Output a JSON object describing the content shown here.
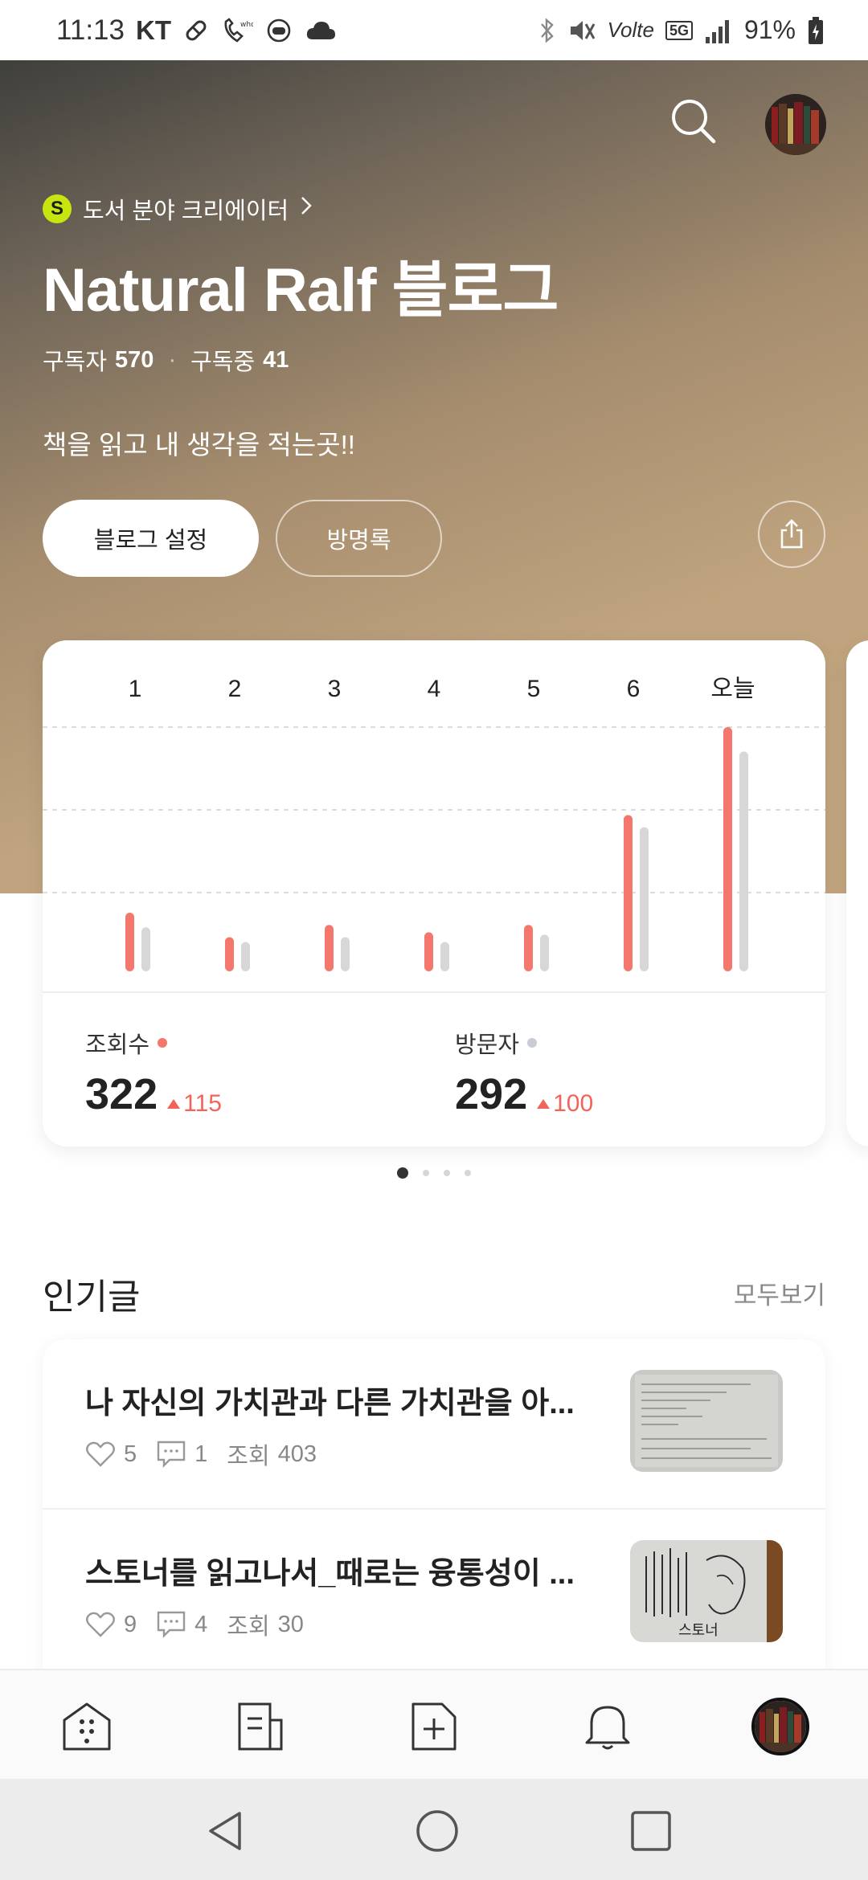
{
  "status_bar": {
    "time": "11:13",
    "carrier": "KT",
    "volte": "Volte",
    "network": "5G",
    "battery": "91%"
  },
  "hero": {
    "category_badge": "S",
    "category": "도서 분야 크리에이터",
    "title": "Natural Ralf 블로그",
    "subscribers_label": "구독자",
    "subscribers": "570",
    "subscribing_label": "구독중",
    "subscribing": "41",
    "description": "책을 읽고 내 생각을 적는곳!!",
    "settings_button": "블로그 설정",
    "guestbook_button": "방명록"
  },
  "stats": {
    "views_label": "조회수",
    "views": "322",
    "views_delta": "115",
    "visitors_label": "방문자",
    "visitors": "292",
    "visitors_delta": "100"
  },
  "chart_data": {
    "type": "bar",
    "categories": [
      "1",
      "2",
      "3",
      "4",
      "5",
      "6",
      "오늘"
    ],
    "series": [
      {
        "name": "조회수",
        "values": [
          48,
          28,
          38,
          32,
          38,
          128,
          200
        ]
      },
      {
        "name": "방문자",
        "values": [
          36,
          24,
          28,
          24,
          30,
          118,
          180
        ]
      }
    ],
    "ylim": [
      0,
      200
    ],
    "grid": true,
    "colors": {
      "views": "#f4776d",
      "visitors": "#d7d7d7"
    }
  },
  "pager": {
    "count": 4,
    "active": 0
  },
  "popular": {
    "title": "인기글",
    "see_all": "모두보기",
    "posts": [
      {
        "title": "나 자신의 가치관과 다른 가치관을 아...",
        "likes": "5",
        "comments": "1",
        "views_label": "조회",
        "views": "403"
      },
      {
        "title": "스토너를 읽고나서_때로는 융통성이 ...",
        "likes": "9",
        "comments": "4",
        "views_label": "조회",
        "views": "30"
      }
    ]
  },
  "bottom_nav": {
    "items": [
      "home-icon",
      "posts-icon",
      "write-icon",
      "bell-icon",
      "profile-avatar"
    ]
  }
}
